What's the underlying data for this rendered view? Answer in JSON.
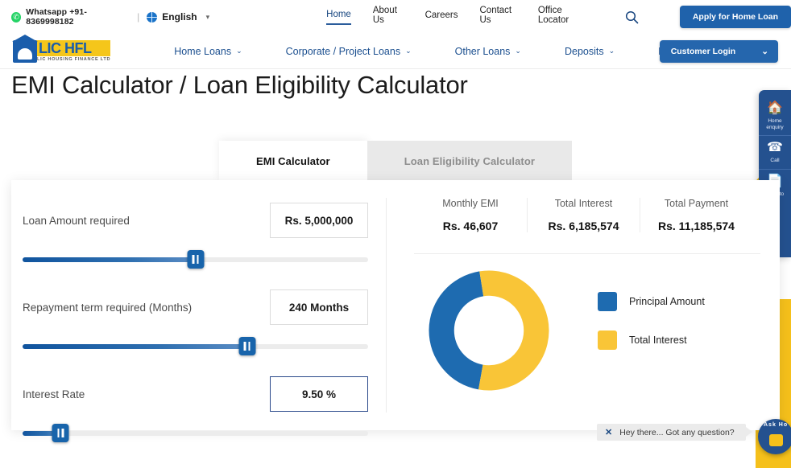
{
  "utility": {
    "whatsapp_icon": "whatsapp-icon",
    "whatsapp_text": "Whatsapp +91-8369998182",
    "separator": "|",
    "globe_icon": "globe-icon",
    "language": "English",
    "language_caret": "▾"
  },
  "top_nav": {
    "items": [
      {
        "label": "Home",
        "active": true
      },
      {
        "label": "About Us",
        "active": false
      },
      {
        "label": "Careers",
        "active": false
      },
      {
        "label": "Contact Us",
        "active": false
      },
      {
        "label": "Office Locator",
        "active": false
      }
    ],
    "search_icon": "search-icon",
    "apply_button": "Apply for Home Loan"
  },
  "brand": {
    "name": "LIC HFL",
    "tagline": "LIC HOUSING FINANCE LTD"
  },
  "main_nav": {
    "items": [
      {
        "label": "Home Loans",
        "caret": "⌄"
      },
      {
        "label": "Corporate / Project Loans",
        "caret": "⌄"
      },
      {
        "label": "Other Loans",
        "caret": "⌄"
      },
      {
        "label": "Deposits",
        "caret": "⌄"
      },
      {
        "label": "Investors",
        "caret": "⌄"
      }
    ],
    "login_button": "Customer Login",
    "login_caret": "⌄"
  },
  "page": {
    "title": "EMI Calculator / Loan Eligibility Calculator"
  },
  "tabs": [
    {
      "label": "EMI Calculator",
      "active": true
    },
    {
      "label": "Loan Eligibility Calculator",
      "active": false
    }
  ],
  "form": {
    "fields": [
      {
        "label": "Loan Amount required",
        "value": "Rs.  5,000,000",
        "slider_percent": 50,
        "focused": false
      },
      {
        "label": "Repayment term required (Months)",
        "value": "240 Months",
        "slider_percent": 65,
        "focused": false
      },
      {
        "label": "Interest Rate",
        "value": "9.50 %",
        "slider_percent": 11,
        "focused": true
      }
    ]
  },
  "results": [
    {
      "label": "Monthly EMI",
      "value": "Rs. 46,607"
    },
    {
      "label": "Total Interest",
      "value": "Rs. 6,185,574"
    },
    {
      "label": "Total Payment",
      "value": "Rs. 11,185,574"
    }
  ],
  "chart_data": {
    "type": "pie",
    "title": "",
    "variant": "donut",
    "legend_position": "right",
    "labels": [
      "Principal Amount",
      "Total Interest"
    ],
    "values": [
      5000000,
      6185574
    ],
    "percentages": [
      44.7,
      55.3
    ],
    "colors": [
      "#1E6BB0",
      "#F9C537"
    ],
    "total": 11185574,
    "start_angle_deg": 100,
    "inner_radius_ratio": 0.58
  },
  "side_widget": {
    "items": [
      {
        "glyph": "⌂",
        "label": "Home\nenquiry",
        "icon": "home-enquiry-icon"
      },
      {
        "glyph": "☎",
        "label": "Call",
        "icon": "call-icon"
      },
      {
        "glyph": "✎",
        "label": "Write to",
        "icon": "write-to-us-icon"
      }
    ]
  },
  "chat": {
    "close_glyph": "✕",
    "message": "Hey there... Got any question?",
    "avatar_label": "Ask Ho"
  },
  "colors": {
    "brand_blue": "#1f62ab",
    "brand_yellow": "#F5C01B",
    "principal": "#1E6BB0",
    "interest": "#F9C537"
  }
}
